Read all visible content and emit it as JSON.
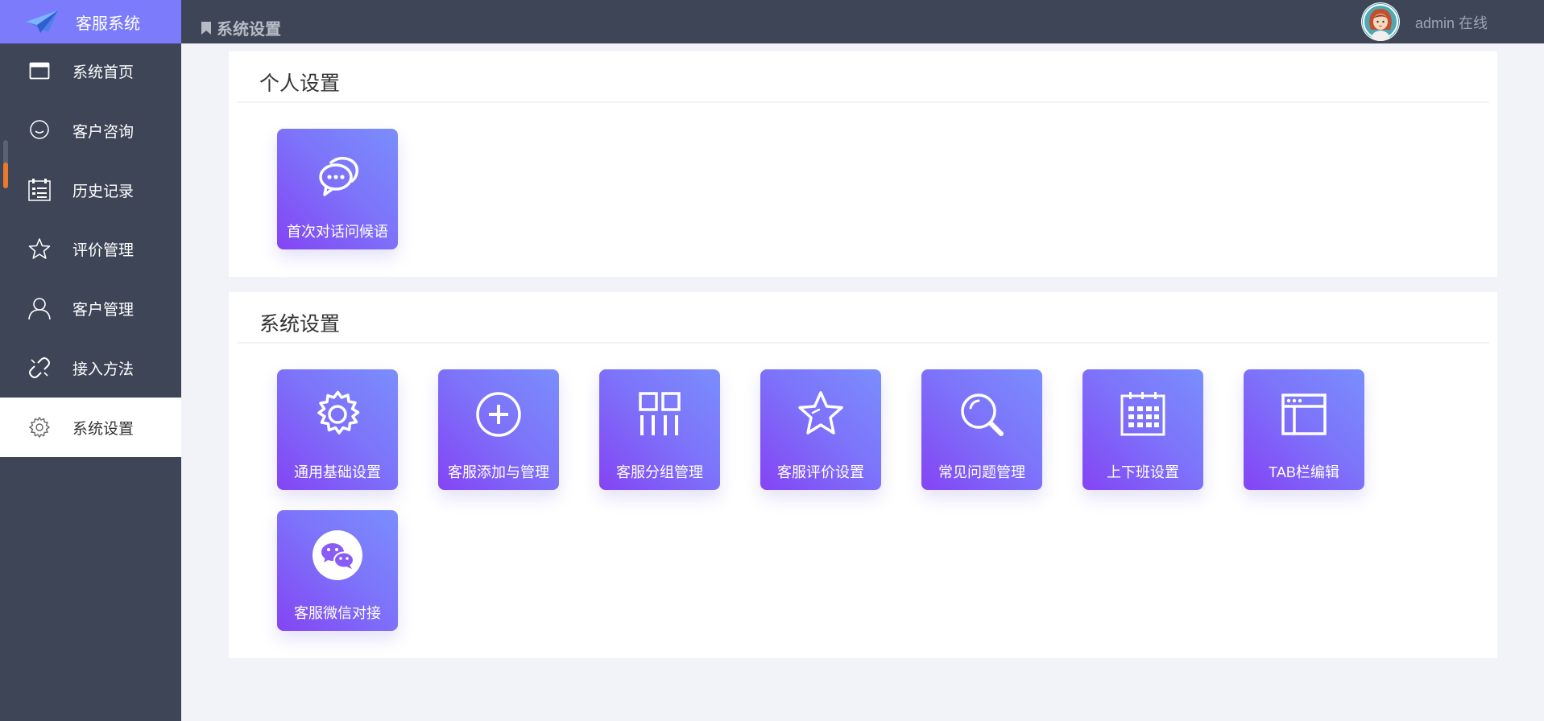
{
  "app": {
    "title": "客服系统"
  },
  "sidebar": {
    "items": [
      {
        "label": "系统首页",
        "icon": "window-icon",
        "active": false
      },
      {
        "label": "客户咨询",
        "icon": "chat-bubble-icon",
        "active": false
      },
      {
        "label": "历史记录",
        "icon": "calendar-list-icon",
        "active": false
      },
      {
        "label": "评价管理",
        "icon": "star-icon",
        "active": false
      },
      {
        "label": "客户管理",
        "icon": "user-icon",
        "active": false
      },
      {
        "label": "接入方法",
        "icon": "link-icon",
        "active": false
      },
      {
        "label": "系统设置",
        "icon": "gear-icon",
        "active": true
      }
    ]
  },
  "header": {
    "breadcrumb": "系统设置",
    "user": "admin 在线"
  },
  "sections": [
    {
      "title": "个人设置",
      "tiles": [
        {
          "label": "首次对话问候语",
          "icon": "chat-bubbles-icon"
        }
      ]
    },
    {
      "title": "系统设置",
      "tiles": [
        {
          "label": "通用基础设置",
          "icon": "gear-icon"
        },
        {
          "label": "客服添加与管理",
          "icon": "plus-circle-icon"
        },
        {
          "label": "客服分组管理",
          "icon": "grid-group-icon"
        },
        {
          "label": "客服评价设置",
          "icon": "star-icon"
        },
        {
          "label": "常见问题管理",
          "icon": "search-icon"
        },
        {
          "label": "上下班设置",
          "icon": "calendar-icon"
        },
        {
          "label": "TAB栏编辑",
          "icon": "browser-window-icon"
        },
        {
          "label": "客服微信对接",
          "icon": "wechat-icon"
        }
      ]
    }
  ],
  "colors": {
    "sidebar_bg": "#3d4557",
    "brand_bg": "#7c7bfb",
    "tile_gradient_start": "#8444f4",
    "tile_gradient_end": "#7a8efc",
    "page_bg": "#f2f3f8",
    "accent_scroll": "#e87a2e"
  }
}
